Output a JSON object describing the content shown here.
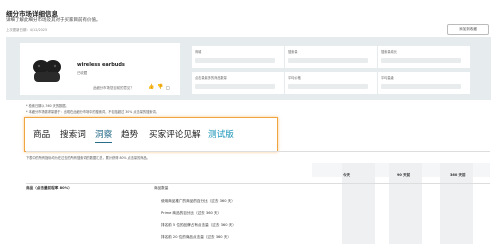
{
  "header": {
    "title": "细分市场详细信息",
    "subtitle": "详细了解此细分市场及其对于买家目前有价值。",
    "updated": "上次更新日期：4/12/2025",
    "top_button": "添加到收藏"
  },
  "product": {
    "name": "wireless earbuds",
    "sub": "已收藏",
    "note": "此细分市场您目前的意见？"
  },
  "metric_cards": [
    {
      "label": "商城"
    },
    {
      "label": "搜索量"
    },
    {
      "label": "搜索量增长"
    },
    {
      "label": "点击量最多的商品数量"
    },
    {
      "label": "平均价格"
    },
    {
      "label": "平均星级"
    }
  ],
  "notes": [
    "* 检索日期以 360 天的数据。",
    "* 本细分市场需求量基于：出现在此细分市场中的搜索词，不包括超过 30% 点击量的搜索词。"
  ],
  "tabs": [
    {
      "label": "商品"
    },
    {
      "label": "搜索词"
    },
    {
      "label": "洞察"
    },
    {
      "label": "趋势"
    },
    {
      "label": "买家评论见解"
    },
    {
      "label": "测试版"
    }
  ],
  "description": "下表中的所有指标均为在过去的所有搜索词的数据汇总，累计获得 80% 点击量的商品。",
  "table": {
    "col_today": "今天",
    "col_90": "90 天前",
    "col_360": "360 天前",
    "section_header": "商品（点击量前程率 80%）",
    "section_col": "商品数量",
    "rows": [
      "使用商品推广的商品的百分比（过去 360 天）",
      "Prime 商品的百分比（过去 360 天）",
      "排名前 5 位的品牌占有点击量（过去 360 天）",
      "排名前 20 位的商品点击量（过去 360 天）"
    ]
  }
}
